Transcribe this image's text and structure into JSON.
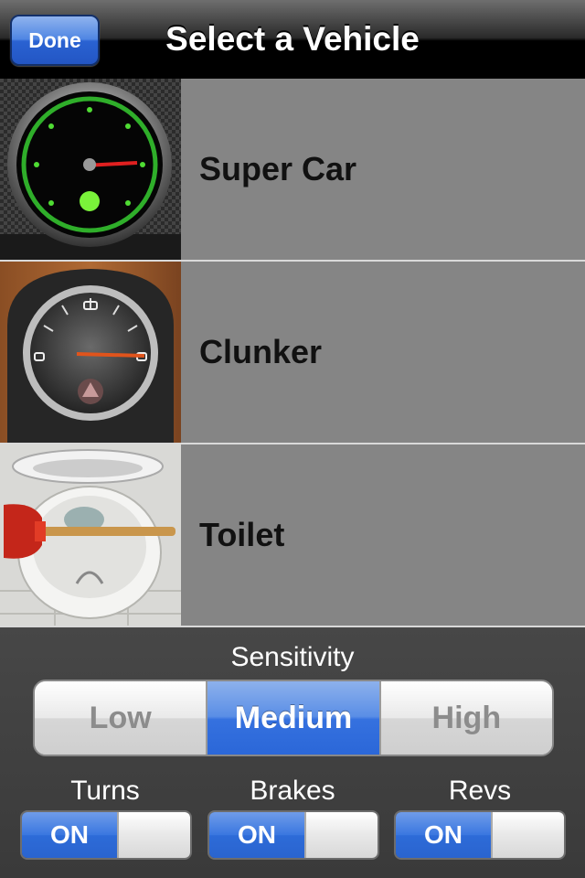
{
  "navbar": {
    "title": "Select a Vehicle",
    "done_label": "Done"
  },
  "vehicles": [
    {
      "label": "Super Car",
      "icon": "supercar-gauge-icon"
    },
    {
      "label": "Clunker",
      "icon": "clunker-gauge-icon"
    },
    {
      "label": "Toilet",
      "icon": "toilet-plunger-icon"
    }
  ],
  "settings": {
    "sensitivity_title": "Sensitivity",
    "sensitivity_options": [
      "Low",
      "Medium",
      "High"
    ],
    "sensitivity_selected": "Medium",
    "toggles": [
      {
        "label": "Turns",
        "state": "ON"
      },
      {
        "label": "Brakes",
        "state": "ON"
      },
      {
        "label": "Revs",
        "state": "ON"
      }
    ]
  },
  "colors": {
    "accent_blue": "#2f6ddb",
    "list_bg": "#858585",
    "panel_bg": "#3f3f3f"
  }
}
